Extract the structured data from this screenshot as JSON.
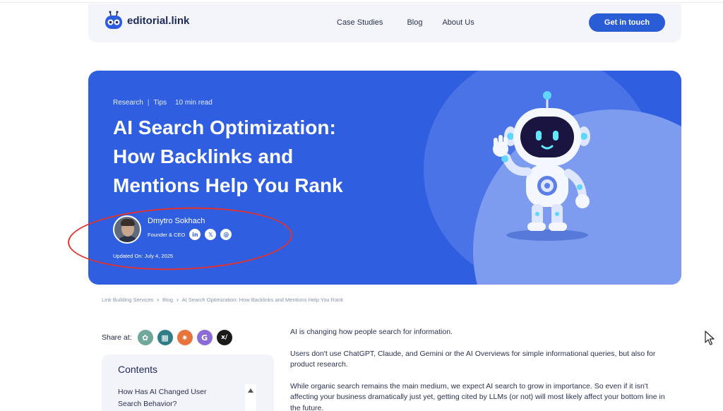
{
  "header": {
    "logo_text": "editorial.link",
    "nav": [
      "Case Studies",
      "Blog",
      "About Us"
    ],
    "cta_label": "Get in touch"
  },
  "hero": {
    "tags": [
      "Research",
      "Tips"
    ],
    "tag_separator": "|",
    "read_time": "10 min read",
    "title_lines": [
      "AI Search Optimization:",
      "How Backlinks and",
      "Mentions Help You Rank"
    ],
    "author_name": "Dmytro Sokhach",
    "author_role": "Founder & CEO",
    "social_icons": [
      "linkedin-icon",
      "x-icon",
      "email-icon"
    ],
    "social_glyphs": [
      "in",
      "𝕏",
      "@"
    ],
    "updated": "Updated On: July 4, 2025"
  },
  "breadcrumb": [
    "Link Building Services",
    "Blog",
    "AI Search Optimization: How Backlinks and Mentions Help You Rank"
  ],
  "breadcrumb_separator": "›",
  "share": {
    "label": "Share at:",
    "icons": [
      {
        "name": "chatgpt-icon",
        "color": "#6fa89a",
        "glyph": "✿"
      },
      {
        "name": "gemini-icon",
        "color": "#2f7d86",
        "glyph": "▦"
      },
      {
        "name": "claude-icon",
        "color": "#e8743b",
        "glyph": "✷"
      },
      {
        "name": "google-icon",
        "color": "#8b6bd6",
        "glyph": "G"
      },
      {
        "name": "grok-icon",
        "color": "#1a1a1a",
        "glyph": "x/"
      }
    ]
  },
  "contents": {
    "title": "Contents",
    "items": [
      "How Has AI Changed User Search Behavior?"
    ]
  },
  "article": {
    "paragraphs": [
      "AI is changing how people search for information.",
      "Users don't use ChatGPT, Claude, and Gemini or the AI Overviews for simple informational queries, but also for product research.",
      "While organic search remains the main medium, we expect AI search to grow in importance. So even if it isn't affecting your business dramatically just yet, getting cited by LLMs (or not) will most likely affect your bottom line in the future."
    ]
  },
  "colors": {
    "brand_blue": "#2f5fe0",
    "cta_blue": "#2a5cd6",
    "annotation_red": "#e3312c"
  }
}
